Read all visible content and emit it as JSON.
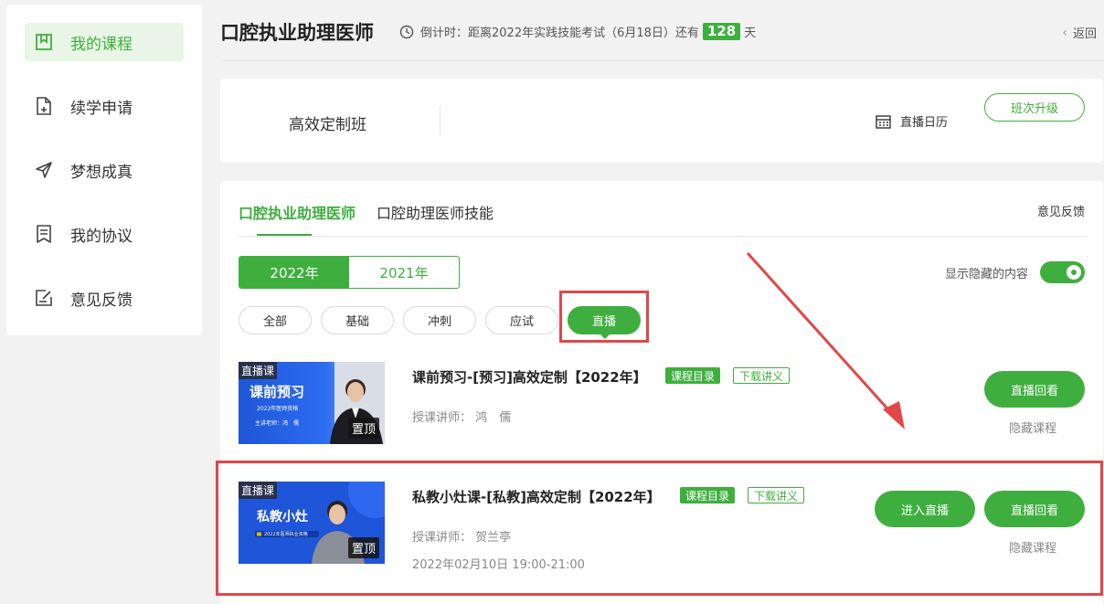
{
  "sidebar": {
    "items": [
      {
        "label": "我的课程",
        "icon": "bookmark-icon",
        "active": true
      },
      {
        "label": "续学申请",
        "icon": "document-add-icon"
      },
      {
        "label": "梦想成真",
        "icon": "paper-plane-icon"
      },
      {
        "label": "我的协议",
        "icon": "agreement-icon"
      },
      {
        "label": "意见反馈",
        "icon": "feedback-edit-icon"
      }
    ]
  },
  "header": {
    "title": "口腔执业助理医师",
    "countdown_prefix": "倒计时：距离2022年实践技能考试（6月18日）还有",
    "countdown_days": "128",
    "countdown_suffix": "天",
    "back_label": "返回"
  },
  "class_card": {
    "class_name": "高效定制班",
    "calendar_label": "直播日历",
    "upgrade_label": "班次升级"
  },
  "tabs": [
    {
      "label": "口腔执业助理医师",
      "active": true
    },
    {
      "label": "口腔助理医师技能"
    }
  ],
  "feedback_label": "意见反馈",
  "years": [
    {
      "label": "2022年",
      "active": true
    },
    {
      "label": "2021年"
    }
  ],
  "show_hidden_label": "显示隐藏的内容",
  "show_hidden_on": true,
  "filters": [
    {
      "label": "全部"
    },
    {
      "label": "基础"
    },
    {
      "label": "冲刺"
    },
    {
      "label": "应试"
    },
    {
      "label": "直播",
      "active": true
    }
  ],
  "courses": [
    {
      "title": "课前预习-[预习]高效定制【2022年】",
      "catalog_label": "课程目录",
      "handout_label": "下载讲义",
      "teacher_label": "授课讲师：",
      "teacher_name": "鸿　儒",
      "thumb_tag": "直播课",
      "thumb_title": "课前预习",
      "thumb_sub1": "2022年医师资格",
      "thumb_sub2": "主讲老师：鸿　儒",
      "pin_label": "置顶",
      "replay_label": "直播回看",
      "hide_label": "隐藏课程"
    },
    {
      "title": "私教小灶课-[私教]高效定制【2022年】",
      "catalog_label": "课程目录",
      "handout_label": "下载讲义",
      "teacher_label": "授课讲师：",
      "teacher_name": "贺兰亭",
      "time": "2022年02月10日 19:00-21:00",
      "thumb_tag": "直播课",
      "thumb_title": "私教小灶",
      "thumb_sub1": "2022年医师执业资格",
      "pin_label": "置顶",
      "enter_label": "进入直播",
      "replay_label": "直播回看",
      "hide_label": "隐藏课程"
    }
  ],
  "colors": {
    "accent": "#3eaf3e",
    "annotation": "#e04848",
    "thumb_blue": "#1f55d8"
  }
}
